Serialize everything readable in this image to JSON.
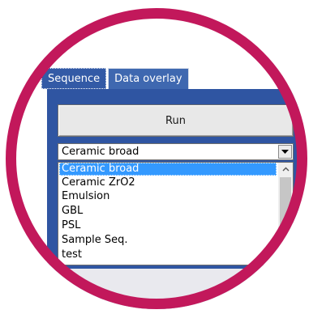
{
  "tabs": [
    {
      "label": "Sequence",
      "active": true
    },
    {
      "label": "Data overlay",
      "active": false
    }
  ],
  "run_button": {
    "label": "Run"
  },
  "sequence_select": {
    "selected": "Ceramic broad",
    "options": [
      "Ceramic broad",
      "Ceramic ZrO2",
      "Emulsion",
      "GBL",
      "PSL",
      "Sample Seq.",
      "test"
    ]
  },
  "colors": {
    "ring": "#c2185b",
    "panel": "#2f55a2",
    "tab": "#3f68b0",
    "selection": "#3399ff"
  },
  "icons": {
    "dropdown": "chevron-down-icon",
    "scroll_up": "scroll-up-arrow-icon",
    "scroll_down": "scroll-down-arrow-icon"
  }
}
